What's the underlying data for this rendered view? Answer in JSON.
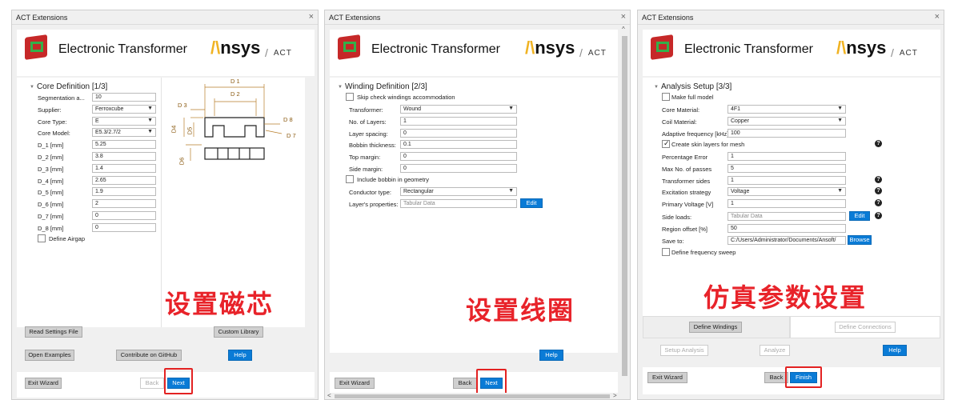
{
  "window_title": "ACT Extensions",
  "close_glyph": "×",
  "product_name": "Electronic Transformer",
  "brand": {
    "ansys_prefix": "/\\",
    "ansys_rest": "nsys",
    "slash": "/",
    "act": "ACT"
  },
  "colors": {
    "accent_blue": "#0a7bd6",
    "highlight_red": "#e32222",
    "ansys_gold": "#f0b323",
    "caption_red": "#e8232a"
  },
  "panel1": {
    "section": "Core Definition [1/3]",
    "fields": [
      {
        "label": "Segmentation a...",
        "value": "10",
        "type": "text"
      },
      {
        "label": "Supplier:",
        "value": "Ferroxcube",
        "type": "select"
      },
      {
        "label": "Core Type:",
        "value": "E",
        "type": "select"
      },
      {
        "label": "Core Model:",
        "value": "E5.3/2.7/2",
        "type": "select"
      },
      {
        "label": "D_1 [mm]",
        "value": "5.25",
        "type": "text"
      },
      {
        "label": "D_2 [mm]",
        "value": "3.8",
        "type": "text"
      },
      {
        "label": "D_3 [mm]",
        "value": "1.4",
        "type": "text"
      },
      {
        "label": "D_4 [mm]",
        "value": "2.65",
        "type": "text"
      },
      {
        "label": "D_5 [mm]",
        "value": "1.9",
        "type": "text"
      },
      {
        "label": "D_6 [mm]",
        "value": "2",
        "type": "text"
      },
      {
        "label": "D_7 [mm]",
        "value": "0",
        "type": "text"
      },
      {
        "label": "D_8 [mm]",
        "value": "0",
        "type": "text"
      }
    ],
    "define_airgap": "Define Airgap",
    "diagram_labels": {
      "d1": "D 1",
      "d2": "D 2",
      "d3": "D 3",
      "d4": "D4",
      "d5": "D5",
      "d6": "D6",
      "d7": "D 7",
      "d8": "D 8"
    },
    "caption": "设置磁芯",
    "buttons": {
      "read_settings": "Read Settings File",
      "custom_library": "Custom Library",
      "open_examples": "Open Examples",
      "contribute": "Contribute on GitHub",
      "help": "Help",
      "exit_wizard": "Exit Wizard",
      "back": "Back",
      "next": "Next"
    }
  },
  "panel2": {
    "section": "Winding Definition [2/3]",
    "skip_check": "Skip check windings accommodation",
    "fields": [
      {
        "label": "Transformer:",
        "value": "Wound",
        "type": "select"
      },
      {
        "label": "No. of Layers:",
        "value": "1",
        "type": "text"
      },
      {
        "label": "Layer spacing:",
        "value": "0",
        "type": "text"
      },
      {
        "label": "Bobbin thickness:",
        "value": "0.1",
        "type": "text"
      },
      {
        "label": "Top margin:",
        "value": "0",
        "type": "text"
      },
      {
        "label": "Side margin:",
        "value": "0",
        "type": "text"
      }
    ],
    "include_bobbin": "Include bobbin in geometry",
    "conductor_label": "Conductor type:",
    "conductor_value": "Rectangular",
    "layer_props_label": "Layer's properties:",
    "layer_props_placeholder": "Tabular Data",
    "edit": "Edit",
    "caption": "设置线圈",
    "buttons": {
      "help": "Help",
      "exit_wizard": "Exit Wizard",
      "back": "Back",
      "next": "Next"
    },
    "scroll_up": "^",
    "scroll_left": "<",
    "scroll_right": ">"
  },
  "panel3": {
    "section": "Analysis Setup [3/3]",
    "make_full_model": "Make full model",
    "fields_a": [
      {
        "label": "Core Material:",
        "value": "4F1",
        "type": "select"
      },
      {
        "label": "Coil Material:",
        "value": "Copper",
        "type": "select"
      },
      {
        "label": "Adaptive frequency [kHz]",
        "value": "100",
        "type": "text"
      }
    ],
    "create_skin": "Create skin layers for mesh",
    "fields_b": [
      {
        "label": "Percentage Error",
        "value": "1",
        "type": "text",
        "help": false
      },
      {
        "label": "Max No. of passes",
        "value": "5",
        "type": "text",
        "help": false
      },
      {
        "label": "Transformer sides",
        "value": "1",
        "type": "text",
        "help": true
      },
      {
        "label": "Excitation strategy",
        "value": "Voltage",
        "type": "select",
        "help": true
      },
      {
        "label": "Primary Voltage [V]",
        "value": "1",
        "type": "text",
        "help": true
      }
    ],
    "side_loads_label": "Side loads:",
    "side_loads_placeholder": "Tabular Data",
    "edit": "Edit",
    "region_label": "Region offset [%]",
    "region_value": "50",
    "save_label": "Save to:",
    "save_value": "C:/Users/Administrator/Documents/Ansoft/",
    "browse": "Browse",
    "define_freq": "Define frequency sweep",
    "help_glyph": "?",
    "caption": "仿真参数设置",
    "tabs": {
      "define_windings": "Define Windings",
      "define_connections": "Define Connections"
    },
    "buttons": {
      "setup_analysis": "Setup Analysis",
      "analyze": "Analyze",
      "help": "Help",
      "exit_wizard": "Exit Wizard",
      "back": "Back",
      "finish": "Finish"
    }
  }
}
